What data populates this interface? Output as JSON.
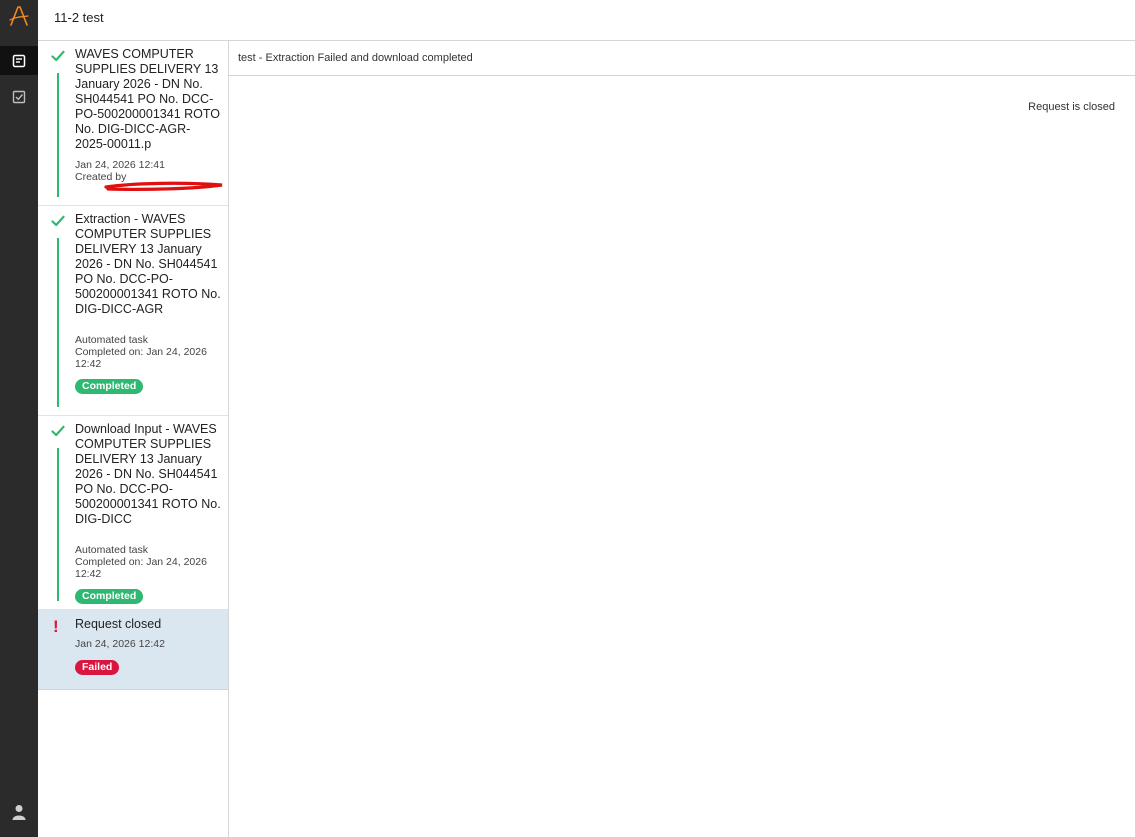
{
  "app": {
    "title": "11-2 test"
  },
  "rail": {
    "icons": [
      "logo-icon",
      "requests-icon",
      "tasks-icon",
      "user-icon"
    ]
  },
  "timeline": {
    "steps": [
      {
        "icon": "check-icon",
        "title": "WAVES COMPUTER SUPPLIES DELIVERY 13 January 2026 - DN No. SH044541 PO No. DCC-PO-500200001341 ROTO No. DIG-DICC-AGR-2025-00011.p",
        "date": "Jan 24, 2026 12:41",
        "created_by": "Created by"
      },
      {
        "icon": "check-icon",
        "title": "Extraction - WAVES COMPUTER SUPPLIES DELIVERY 13 January 2026 - DN No. SH044541 PO No. DCC-PO-500200001341 ROTO No. DIG-DICC-AGR",
        "meta1": "Automated task",
        "meta2": "Completed on: Jan 24, 2026 12:42",
        "status": "Completed"
      },
      {
        "icon": "check-icon",
        "title": "Download Input - WAVES COMPUTER SUPPLIES DELIVERY 13 January 2026 - DN No. SH044541 PO No. DCC-PO-500200001341 ROTO No. DIG-DICC",
        "meta1": "Automated task",
        "meta2": "Completed on: Jan 24, 2026 12:42",
        "status": "Completed"
      },
      {
        "icon": "exclamation-icon",
        "title": "Request closed",
        "date": "Jan 24, 2026 12:42",
        "status": "Failed"
      }
    ]
  },
  "main": {
    "subheader": "test - Extraction Failed and download completed",
    "status_text": "Request is closed"
  },
  "colors": {
    "rail_bg": "#2b2b2b",
    "success": "#2eb872",
    "failure": "#d9163f",
    "selected_bg": "#dbe7f0",
    "logo": "#f08a24"
  }
}
